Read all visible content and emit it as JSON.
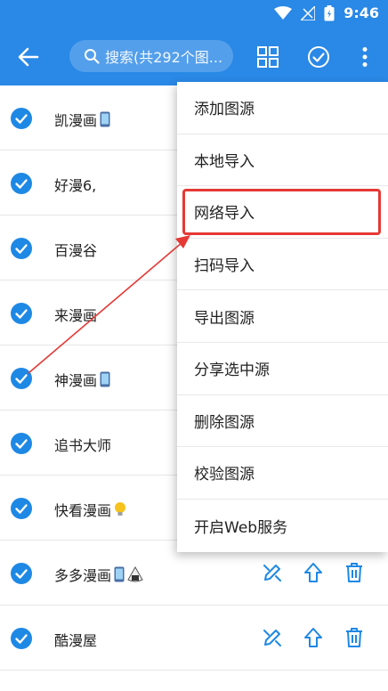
{
  "status_bar": {
    "time": "9:46"
  },
  "toolbar": {
    "search_placeholder": "搜索(共292个图..."
  },
  "sources": [
    {
      "label": "凯漫画",
      "badge": "phone"
    },
    {
      "label": "好漫6,",
      "badge": ""
    },
    {
      "label": "百漫谷",
      "badge": ""
    },
    {
      "label": "来漫画",
      "badge": ""
    },
    {
      "label": "神漫画",
      "badge": "phone"
    },
    {
      "label": "追书大师",
      "badge": ""
    },
    {
      "label": "快看漫画",
      "badge": "bulb"
    },
    {
      "label": "多多漫画",
      "badge": "phone+rice"
    },
    {
      "label": "酷漫屋",
      "badge": ""
    }
  ],
  "menu": {
    "items": [
      "添加图源",
      "本地导入",
      "网络导入",
      "扫码导入",
      "导出图源",
      "分享选中源",
      "删除图源",
      "校验图源",
      "开启Web服务"
    ],
    "highlighted": "网络导入"
  },
  "colors": {
    "primary": "#2a88e6",
    "check": "#1e88e5",
    "highlight": "#e53935"
  },
  "icons": {
    "toolbar": [
      "back-arrow-icon",
      "search-icon",
      "grid-view-icon",
      "check-circle-icon",
      "more-vert-icon"
    ],
    "row_actions": [
      "edit-icon",
      "move-top-icon",
      "delete-icon"
    ]
  }
}
